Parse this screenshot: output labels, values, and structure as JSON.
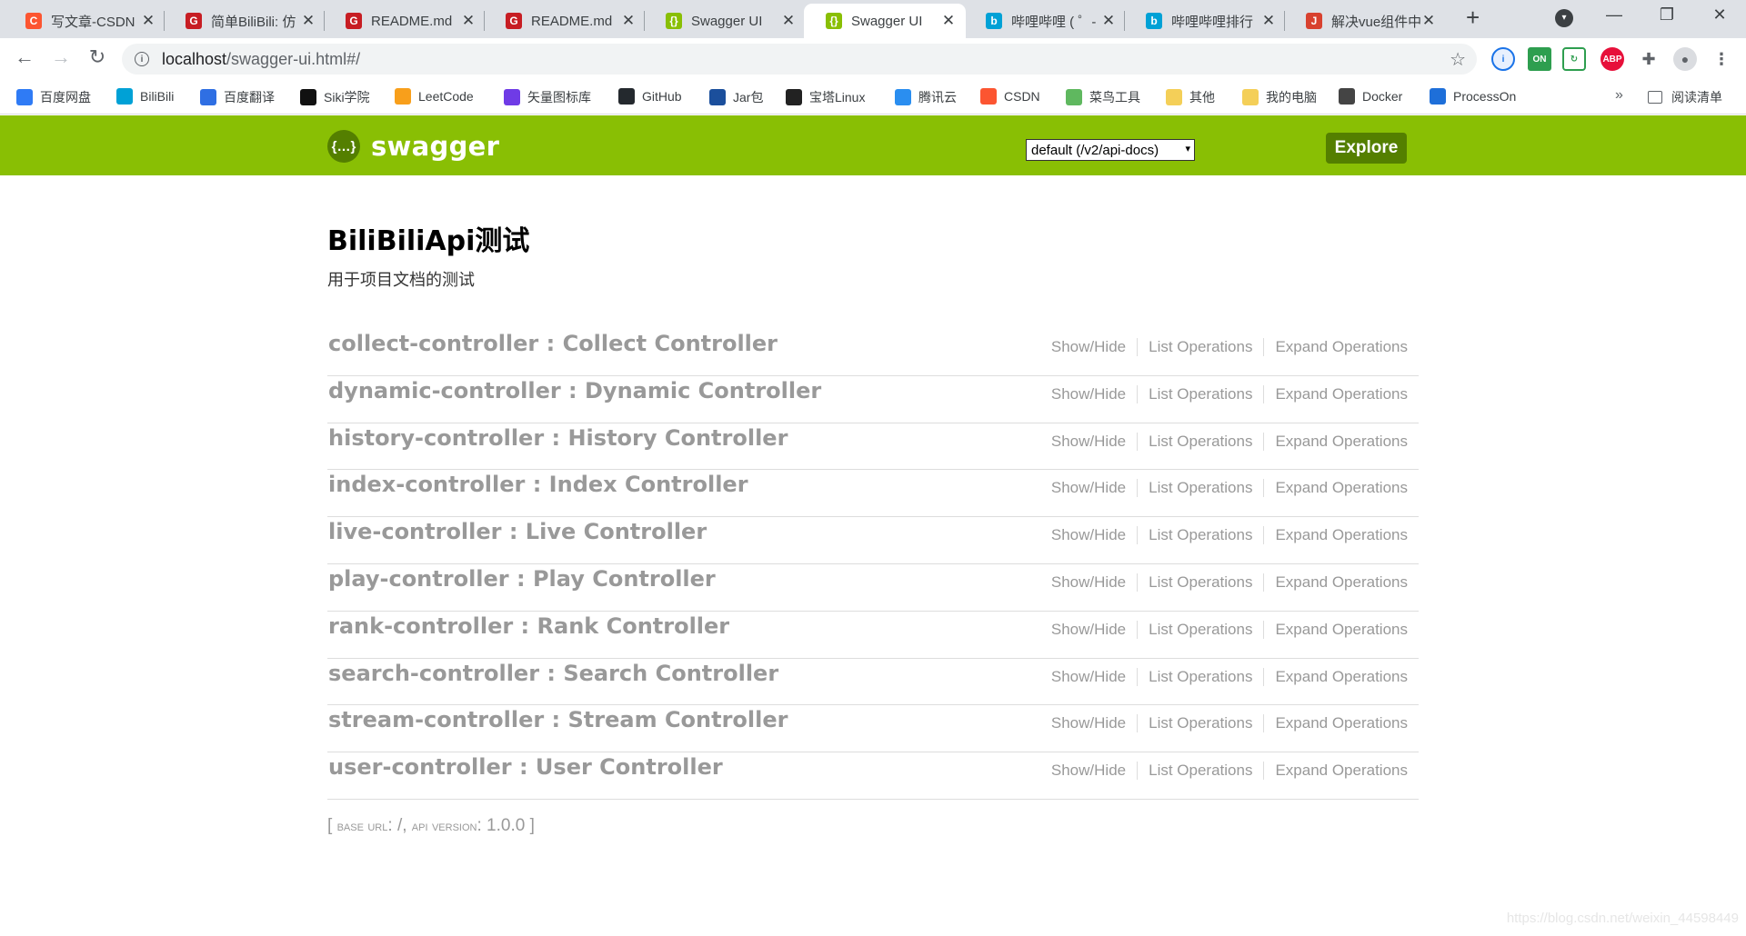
{
  "browser": {
    "tabs": [
      {
        "title": "写文章-CSDN",
        "icon": "csdn-icon",
        "color": "#fc5531",
        "glyph": "C"
      },
      {
        "title": "简单BiliBili: 仿",
        "icon": "gitee-icon",
        "color": "#c71d23",
        "glyph": "G"
      },
      {
        "title": "README.md",
        "icon": "gitee-icon",
        "color": "#c71d23",
        "glyph": "G"
      },
      {
        "title": "README.md",
        "icon": "gitee-icon",
        "color": "#c71d23",
        "glyph": "G"
      },
      {
        "title": "Swagger UI",
        "icon": "swagger-icon",
        "color": "#89bf04",
        "glyph": "{}"
      },
      {
        "title": "Swagger UI",
        "icon": "swagger-icon",
        "color": "#89bf04",
        "glyph": "{}"
      },
      {
        "title": "哔哩哔哩 ( ゜-",
        "icon": "bilibili-icon",
        "color": "#00a1d6",
        "glyph": "b"
      },
      {
        "title": "哔哩哔哩排行",
        "icon": "bilibili-icon",
        "color": "#00a1d6",
        "glyph": "b"
      },
      {
        "title": "解决vue组件中",
        "icon": "js-icon",
        "color": "#d8412f",
        "glyph": "J"
      }
    ],
    "url_host": "localhost",
    "url_path": "/swagger-ui.html#/",
    "bookmarks": [
      {
        "label": "百度网盘",
        "icon": "baidu-pan-icon",
        "color": "#2f7bf5"
      },
      {
        "label": "BiliBili",
        "icon": "bilibili-icon",
        "color": "#00a1d6"
      },
      {
        "label": "百度翻译",
        "icon": "baidu-translate-icon",
        "color": "#2f6fe3"
      },
      {
        "label": "Siki学院",
        "icon": "siki-icon",
        "color": "#111111"
      },
      {
        "label": "LeetCode",
        "icon": "leetcode-icon",
        "color": "#f89f1b"
      },
      {
        "label": "矢量图标库",
        "icon": "iconfont-icon",
        "color": "#6f3be6"
      },
      {
        "label": "GitHub",
        "icon": "github-icon",
        "color": "#24292e"
      },
      {
        "label": "Jar包",
        "icon": "maven-icon",
        "color": "#1b4f9c"
      },
      {
        "label": "宝塔Linux",
        "icon": "bt-icon",
        "color": "#222222"
      },
      {
        "label": "腾讯云",
        "icon": "tencent-cloud-icon",
        "color": "#2a8ef0"
      },
      {
        "label": "CSDN",
        "icon": "csdn-icon",
        "color": "#fc5531"
      },
      {
        "label": "菜鸟工具",
        "icon": "runoob-icon",
        "color": "#5fb85f"
      },
      {
        "label": "其他",
        "icon": "folder-icon",
        "color": "#f4cf58"
      },
      {
        "label": "我的电脑",
        "icon": "folder-icon",
        "color": "#f4cf58"
      },
      {
        "label": "Docker",
        "icon": "docker-icon",
        "color": "#444444"
      },
      {
        "label": "ProcessOn",
        "icon": "processon-icon",
        "color": "#1e6fd9"
      }
    ],
    "more_bookmarks": "»",
    "reading_list": "阅读清单"
  },
  "swagger": {
    "logo_text": "swagger",
    "spec_select": "default (/v2/api-docs)",
    "explore_label": "Explore",
    "api_title": "BiliBiliApi测试",
    "api_description": "用于项目文档的测试",
    "operations_labels": {
      "show_hide": "Show/Hide",
      "list": "List Operations",
      "expand": "Expand Operations"
    },
    "resources": [
      {
        "name": "collect-controller : Collect Controller"
      },
      {
        "name": "dynamic-controller : Dynamic Controller"
      },
      {
        "name": "history-controller : History Controller"
      },
      {
        "name": "index-controller : Index Controller"
      },
      {
        "name": "live-controller : Live Controller"
      },
      {
        "name": "play-controller : Play Controller"
      },
      {
        "name": "rank-controller : Rank Controller"
      },
      {
        "name": "search-controller : Search Controller"
      },
      {
        "name": "stream-controller : Stream Controller"
      },
      {
        "name": "user-controller : User Controller"
      }
    ],
    "footer": {
      "open_bracket": "[",
      "base_url_label": "base url",
      "base_url_value": "/",
      "api_version_label": "api version",
      "api_version_value": "1.0.0",
      "close_bracket": "]"
    }
  },
  "watermark": "https://blog.csdn.net/weixin_44598449",
  "colors": {
    "swagger_green": "#89bf04",
    "swagger_dark_green": "#547f00",
    "resource_text": "#999999"
  }
}
